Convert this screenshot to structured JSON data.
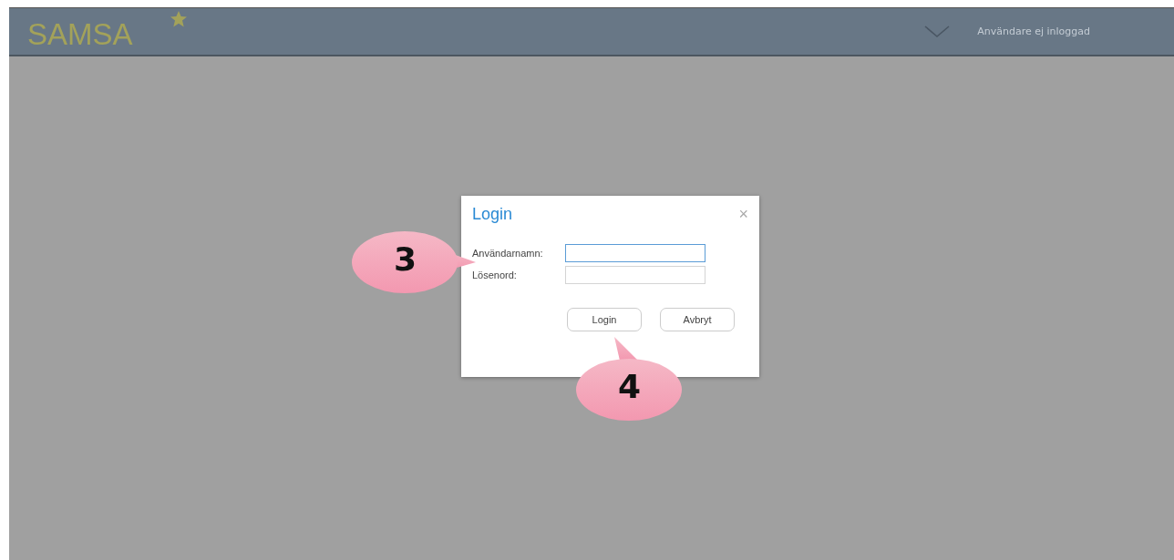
{
  "header": {
    "logo": "SAMSA",
    "favorite": true,
    "user_status": "Användare ej inloggad"
  },
  "dialog": {
    "title": "Login",
    "close": "×",
    "fields": [
      {
        "label": "Användarnamn:",
        "focused": true
      },
      {
        "label": "Lösenord:",
        "focused": false
      }
    ],
    "buttons": [
      "Login",
      "Avbryt"
    ]
  },
  "callouts": [
    {
      "number": "3",
      "kind": "side"
    },
    {
      "number": "4",
      "kind": "below"
    }
  ]
}
